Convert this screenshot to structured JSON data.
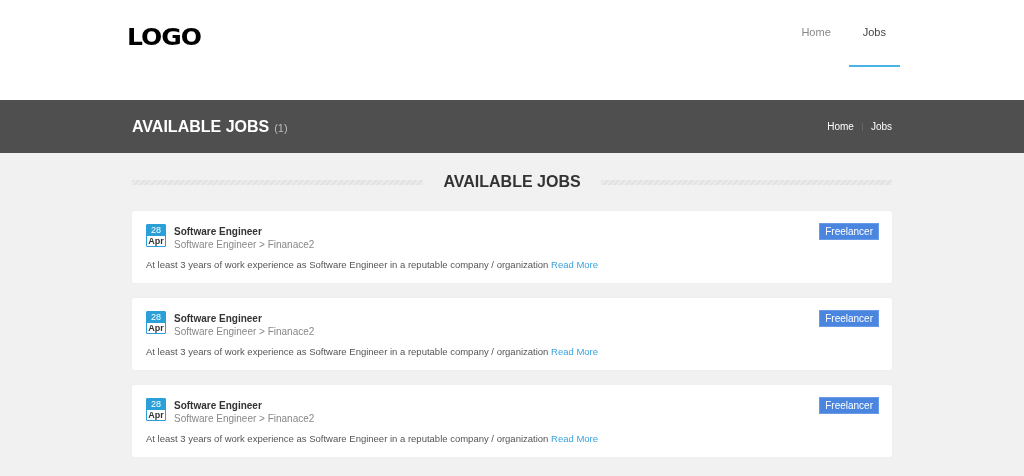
{
  "header": {
    "logo": "LOGO",
    "nav": [
      {
        "label": "Home",
        "selected": false
      },
      {
        "label": "Jobs",
        "selected": true
      }
    ]
  },
  "banner": {
    "title": "AVAILABLE JOBS",
    "count": "(1)",
    "breadcrumbs": [
      "Home",
      "Jobs"
    ]
  },
  "section_title": "AVAILABLE JOBS",
  "jobs": [
    {
      "day": "28",
      "month": "Apr",
      "title": "Software Engineer",
      "path": "Software Engineer > Finanace2",
      "description": "At least 3 years of work experience as Software Engineer in a reputable company / organization",
      "link": "Read More",
      "badge": "Freelancer"
    },
    {
      "day": "28",
      "month": "Apr",
      "title": "Software Engineer",
      "path": "Software Engineer > Finanace2",
      "description": "At least 3 years of work experience as Software Engineer in a reputable company / organization",
      "link": "Read More",
      "badge": "Freelancer"
    },
    {
      "day": "28",
      "month": "Apr",
      "title": "Software Engineer",
      "path": "Software Engineer > Finanace2",
      "description": "At least 3 years of work experience as Software Engineer in a reputable company / organization",
      "link": "Read More",
      "badge": "Freelancer"
    }
  ]
}
